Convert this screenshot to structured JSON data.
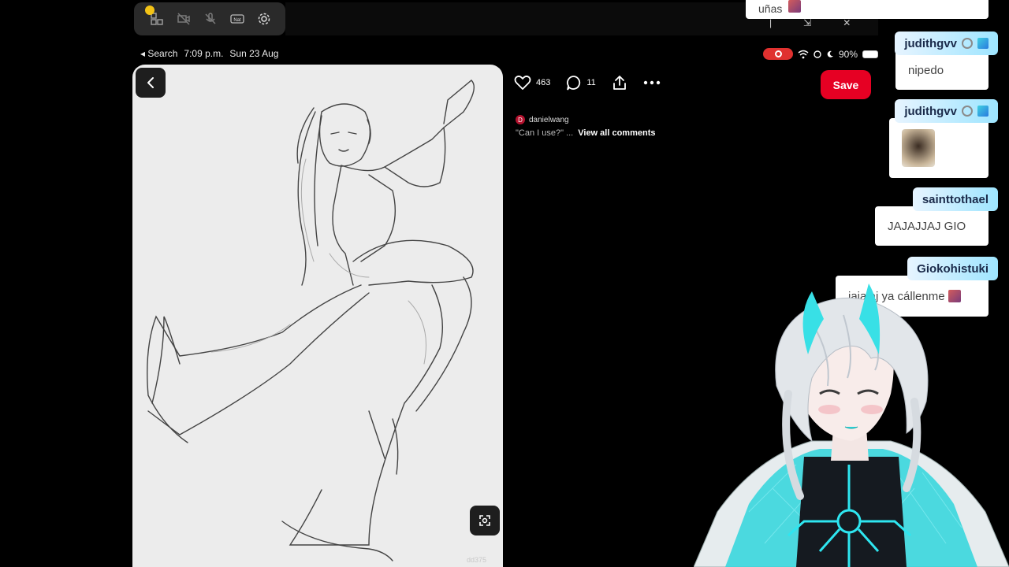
{
  "toolbar": {
    "icons": [
      "cursor-dot-icon",
      "camera-off-icon",
      "mic-off-icon",
      "nat-badge-icon",
      "gear-icon"
    ],
    "nat_label": "Nat"
  },
  "status_bar": {
    "back_label": "◂ Search",
    "time": "7:09 p.m.",
    "date": "Sun 23 Aug",
    "battery": "90%"
  },
  "pin": {
    "like_count": "463",
    "comment_count": "11",
    "save_label": "Save",
    "author": "danielwang",
    "author_initial": "D",
    "comment_snippet": "\"Can I use?\" ...",
    "view_all": "View all comments",
    "watermark": "dd375"
  },
  "chat": {
    "top_partial": "uñas",
    "messages": [
      {
        "user": "judithgvv",
        "text": "nipedo"
      },
      {
        "user": "judithgvv",
        "text": ""
      },
      {
        "user": "sainttothael",
        "text": "JAJAJJAJ GIO"
      },
      {
        "user": "Giokohistuki",
        "text": "jajajaj ya cállenme"
      }
    ]
  },
  "colors": {
    "save": "#e60023",
    "record": "#e0312f",
    "chat_name_gradient_end": "#9ee5ff"
  }
}
